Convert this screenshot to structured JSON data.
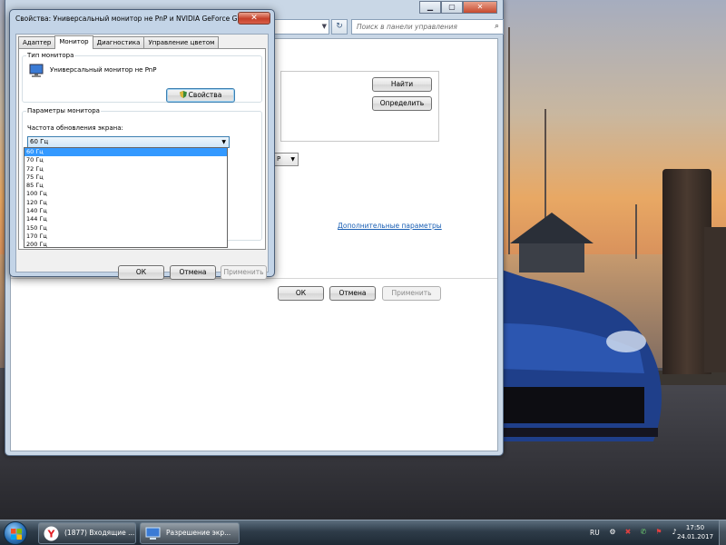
{
  "background_window": {
    "controls": {
      "minimize": "▁",
      "maximize": "▢",
      "close": "✕"
    },
    "search_placeholder": "Поиск в панели управления",
    "find_button": "Найти",
    "detect_button": "Определить",
    "small_select_value": "P",
    "advanced_link": "Дополнительные параметры",
    "ok_button": "ОК",
    "cancel_button": "Отмена",
    "apply_button": "Применить"
  },
  "dialog": {
    "title": "Свойства: Универсальный монитор не PnP и NVIDIA GeForce G...",
    "close_glyph": "✕",
    "tabs": [
      {
        "label": "Адаптер"
      },
      {
        "label": "Монитор",
        "active": true
      },
      {
        "label": "Диагностика"
      },
      {
        "label": "Управление цветом"
      }
    ],
    "monitor_type_group": "Тип монитора",
    "monitor_name": "Универсальный монитор не PnP",
    "properties_button": "Свойства",
    "monitor_settings_group": "Параметры монитора",
    "refresh_rate_label": "Частота обновления экрана:",
    "refresh_rate_selected": "60 Гц",
    "refresh_rate_options": [
      "60 Гц",
      "70 Гц",
      "72 Гц",
      "75 Гц",
      "85 Гц",
      "100 Гц",
      "120 Гц",
      "140 Гц",
      "144 Гц",
      "150 Гц",
      "170 Гц",
      "200 Гц"
    ],
    "highlighted_option": "60 Гц",
    "ok_button": "ОК",
    "cancel_button": "Отмена",
    "apply_button": "Применить"
  },
  "taskbar": {
    "items": [
      {
        "label": "(1877) Входящие ...",
        "icon": "yandex-browser-icon"
      },
      {
        "label": "Разрешение экр...",
        "icon": "display-settings-icon",
        "active": true
      }
    ],
    "language": "RU",
    "time": "17:50",
    "date": "24.01.2017"
  },
  "colors": {
    "selection": "#3399ff",
    "link": "#1a5fb4",
    "window_frame": "#c3d4e7",
    "close_button": "#c5402a"
  }
}
